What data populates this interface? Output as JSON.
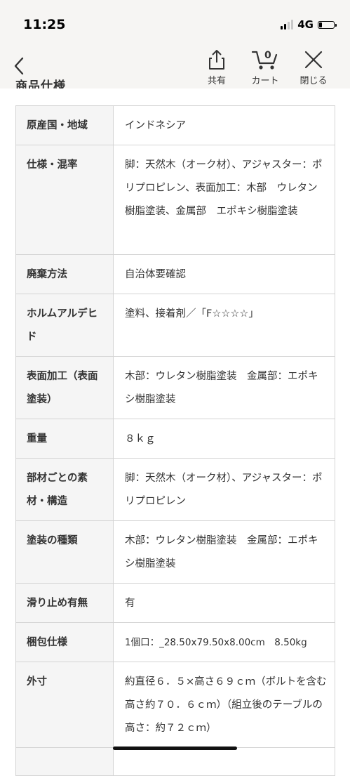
{
  "status_bar": {
    "time": "11:25",
    "network": "4G",
    "signal_bars_active": 2,
    "signal_bars_total": 4,
    "battery_level": 0.2
  },
  "nav": {
    "back_icon": "chevron-left-icon",
    "actions": [
      {
        "label": "共有",
        "icon": "share-icon"
      },
      {
        "label": "カート",
        "icon": "cart-icon",
        "badge": "0"
      },
      {
        "label": "閉じる",
        "icon": "close-icon"
      }
    ]
  },
  "section_heading": "商品仕様",
  "specs": [
    {
      "label": "原産国・地域",
      "value": "インドネシア"
    },
    {
      "label": "仕様・混率",
      "value": "脚：天然木（オーク材）、アジャスター：ポリプロピレン、表面加工：木部　ウレタン樹脂塗装、金属部　エポキシ樹脂塗装"
    },
    {
      "label": "廃棄方法",
      "value": "自治体要確認"
    },
    {
      "label": "ホルムアルデヒド",
      "value": "塗料、接着剤／「F☆☆☆☆」"
    },
    {
      "label": "表面加工（表面塗装）",
      "value": "木部：ウレタン樹脂塗装　金属部：エポキシ樹脂塗装"
    },
    {
      "label": "重量",
      "value": "８ｋｇ"
    },
    {
      "label": "部材ごとの素材・構造",
      "value": "脚：天然木（オーク材）、アジャスター：ポリプロピレン"
    },
    {
      "label": "塗装の種類",
      "value": "木部：ウレタン樹脂塗装　金属部：エポキシ樹脂塗装"
    },
    {
      "label": "滑り止め有無",
      "value": "有"
    },
    {
      "label": "梱包仕様",
      "value": "1個口：_28.50x79.50x8.00cm　8.50kg"
    },
    {
      "label": "外寸",
      "value": "約直径６．５×高さ６９ｃｍ（ボルトを含む高さ約７０．６ｃｍ）（組立後のテーブルの高さ：約７２ｃｍ）"
    },
    {
      "label": "",
      "value": ""
    }
  ]
}
